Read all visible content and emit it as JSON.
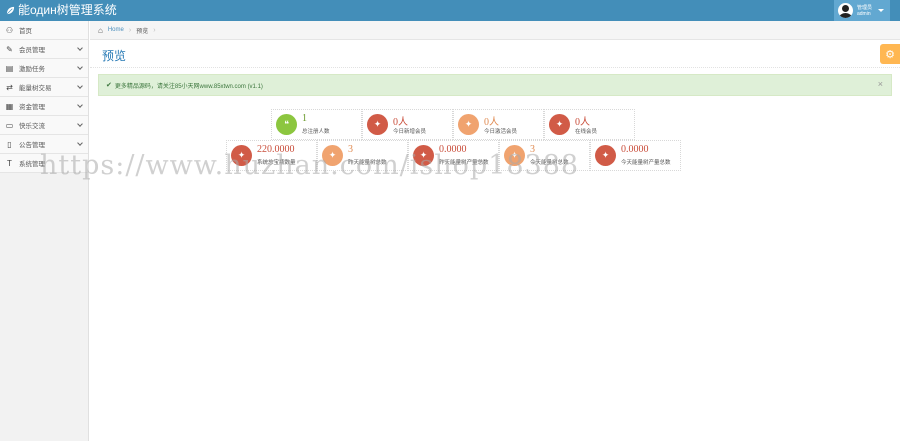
{
  "app": {
    "title": "能один树管理系统"
  },
  "user": {
    "role": "管理员",
    "name": "admin"
  },
  "sidebar": {
    "items": [
      {
        "label": "首页",
        "icon": "dashboard-icon",
        "glyph": "⚇",
        "has_submenu": false
      },
      {
        "label": "会员管理",
        "icon": "edit-icon",
        "glyph": "✎",
        "has_submenu": true
      },
      {
        "label": "激励任务",
        "icon": "list-icon",
        "glyph": "▤",
        "has_submenu": true
      },
      {
        "label": "能量树交易",
        "icon": "shuffle-icon",
        "glyph": "⇄",
        "has_submenu": true
      },
      {
        "label": "资金管理",
        "icon": "calendar-icon",
        "glyph": "▦",
        "has_submenu": true
      },
      {
        "label": "快乐交流",
        "icon": "card-icon",
        "glyph": "▭",
        "has_submenu": true
      },
      {
        "label": "公告管理",
        "icon": "file-icon",
        "glyph": "▯",
        "has_submenu": true
      },
      {
        "label": "系统管理",
        "icon": "text-icon",
        "glyph": "T",
        "has_submenu": false
      }
    ]
  },
  "breadcrumb": {
    "home": "Home",
    "current": "预览"
  },
  "page": {
    "title": "预览"
  },
  "alert": {
    "text": "更多精品源码，请关注85小天网www.85xtwn.com (v1.1)"
  },
  "stats_row1": [
    {
      "value": "1",
      "label": "总注册人数",
      "color": "green"
    },
    {
      "value": "0人",
      "label": "今日新增会员",
      "color": "red"
    },
    {
      "value": "0人",
      "label": "今日激活会员",
      "color": "orange"
    },
    {
      "value": "0人",
      "label": "在线会员",
      "color": "red"
    }
  ],
  "stats_row2": [
    {
      "value": "220.0000",
      "label": "系统总宝瓶数量",
      "color": "red"
    },
    {
      "value": "3",
      "label": "昨天能量树总数",
      "color": "orange"
    },
    {
      "value": "0.0000",
      "label": "昨天能量树产量总数",
      "color": "red"
    },
    {
      "value": "3",
      "label": "今天能量树总数",
      "color": "orange"
    },
    {
      "value": "0.0000",
      "label": "今天能量树产量总数",
      "color": "red"
    }
  ],
  "watermark": "https://www.huzhan.com/ishop18388",
  "colors": {
    "navbar": "#438eb9",
    "accent": "#2679b5",
    "alert_bg": "#dff0d8",
    "green": "#8cc63f",
    "red": "#d15b47",
    "orange": "#f0a36f"
  }
}
